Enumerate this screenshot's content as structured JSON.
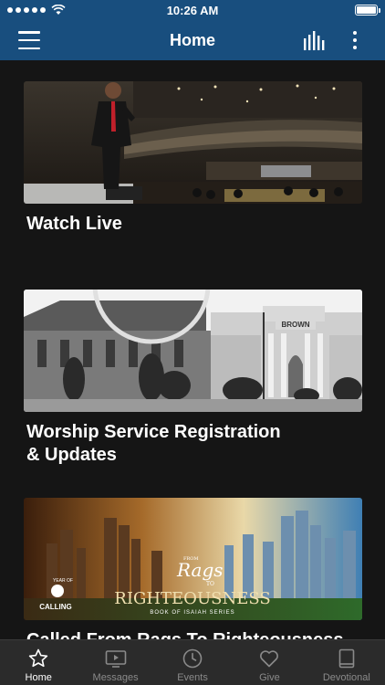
{
  "status_bar": {
    "time": "10:26 AM"
  },
  "header": {
    "title": "Home"
  },
  "cards": [
    {
      "title": "Watch Live"
    },
    {
      "title": "Worship Service Registration\n& Updates",
      "building_sign": "BROWN"
    },
    {
      "title": "Called From Rags To Righteousness",
      "banner": {
        "from": "FROM",
        "rags": "Rags",
        "to": "TO",
        "righteousness": "RIGHTEOUSNESS",
        "series": "BOOK OF ISAIAH SERIES",
        "year_of": "YEAR OF",
        "calling": "CALLING"
      }
    }
  ],
  "tabs": [
    {
      "label": "Home",
      "icon": "star-icon",
      "active": true
    },
    {
      "label": "Messages",
      "icon": "play-screen-icon"
    },
    {
      "label": "Events",
      "icon": "clock-icon"
    },
    {
      "label": "Give",
      "icon": "heart-icon"
    },
    {
      "label": "Devotional",
      "icon": "book-icon"
    }
  ],
  "colors": {
    "header": "#184e7e",
    "background": "#151515",
    "tab_bar": "#2b2b2b",
    "inactive_tab": "#8a8a8a"
  }
}
